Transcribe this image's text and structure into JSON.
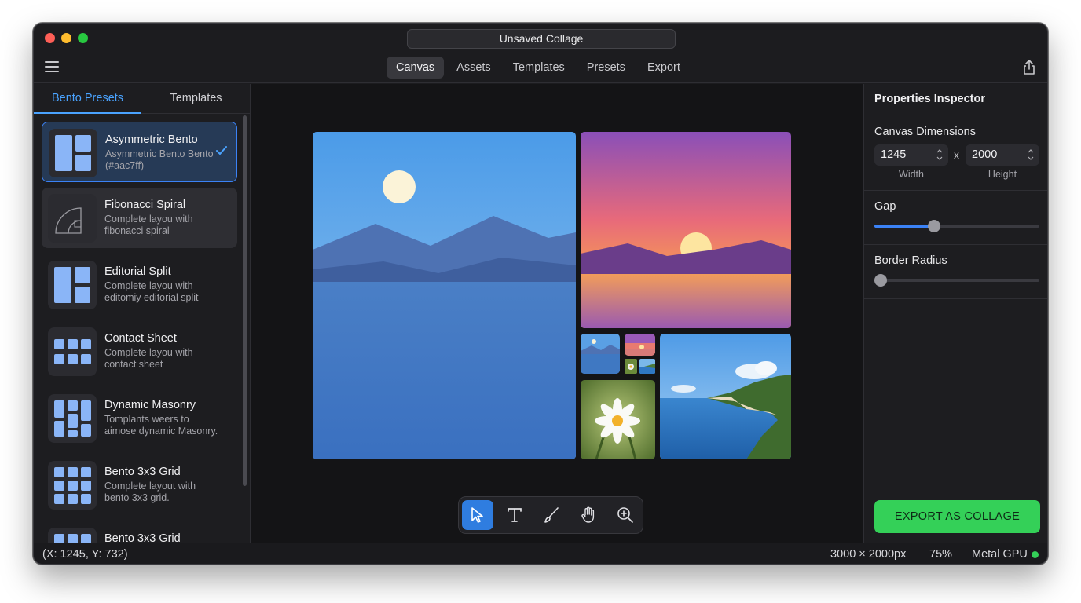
{
  "window": {
    "title": "Unsaved Collage"
  },
  "toolbar": {
    "tabs": [
      "Canvas",
      "Assets",
      "Templates",
      "Presets",
      "Export"
    ],
    "active_tab": "Canvas"
  },
  "sidebar": {
    "tabs": [
      "Bento Presets",
      "Templates"
    ],
    "active_tab": "Bento Presets",
    "presets": [
      {
        "name": "Asymmetric Bento",
        "desc": "Asymmetric Bento Bento (#aac7ff)",
        "selected": true
      },
      {
        "name": "Fibonacci Spiral",
        "desc": "Complete layou with fibonacci spiral"
      },
      {
        "name": "Editorial Split",
        "desc": "Complete layou with editomiy editorial split"
      },
      {
        "name": "Contact Sheet",
        "desc": "Complete layou with contact sheet"
      },
      {
        "name": "Dynamic Masonry",
        "desc": "Tomplants weers to aimose dynamic Masonry."
      },
      {
        "name": "Bento 3x3 Grid",
        "desc": "Complete layout with bento 3x3 grid."
      },
      {
        "name": "Bento 3x3 Grid",
        "desc": ""
      }
    ]
  },
  "canvas": {
    "tools": [
      "select-tool",
      "text-tool",
      "brush-tool",
      "hand-tool",
      "zoom-tool"
    ],
    "active_tool": "select-tool"
  },
  "inspector": {
    "title": "Properties Inspector",
    "canvas_dimensions_label": "Canvas Dimensions",
    "width_value": "1245",
    "height_value": "2000",
    "separator": "x",
    "width_caption": "Width",
    "height_caption": "Height",
    "gap_label": "Gap",
    "gap_value": 0.36,
    "border_radius_label": "Border Radius",
    "border_radius_value": 0.0,
    "export_button": "EXPORT AS COLLAGE"
  },
  "statusbar": {
    "coords": "(X: 1245, Y: 732)",
    "dimensions": "3000 × 2000px",
    "zoom": "75%",
    "gpu": "Metal GPU"
  },
  "colors": {
    "accent": "#3b82f6",
    "export_green": "#34d058",
    "selected_bg": "#263a56"
  }
}
